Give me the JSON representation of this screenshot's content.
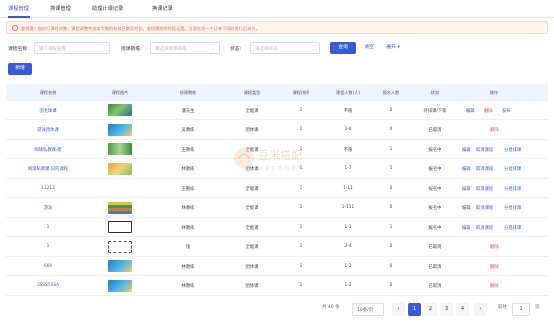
{
  "tabs": [
    {
      "label": "课程管理",
      "active": true
    },
    {
      "label": "排课管理",
      "active": false
    },
    {
      "label": "助理计课记录",
      "active": false
    },
    {
      "label": "换课记录",
      "active": false
    }
  ],
  "notice": "查找课：指执行课时调整，课程调整完成本学期的有效日期及时长。查找课程的时段设置。注意在同一个订单下同时进行后调价。",
  "filters": {
    "course_name_label": "课程名称:",
    "course_name_placeholder": "输入课程名称",
    "teacher_label": "授课教练:",
    "teacher_placeholder": "请选择授课教练",
    "status_label": "状态:",
    "status_placeholder": "请选择状态",
    "search_button": "查询",
    "reset_button": "清空",
    "expand_link": "展开"
  },
  "add_button": "新增",
  "columns": [
    "课程名称",
    "课程图片",
    "授课教练",
    "课程类型",
    "课程排序",
    "课程人数(人)",
    "报名人数",
    "状态",
    "操作"
  ],
  "rows": [
    {
      "name": "羽毛球课",
      "thumb": "thumb-court-green",
      "coach": "潘先生",
      "type": "全能课",
      "sort": "1",
      "capacity": "不限",
      "enrolled": "0",
      "status": "待排课/下架",
      "actions": [
        {
          "label": "编辑",
          "color": "blue"
        },
        {
          "label": "删除",
          "color": "red"
        },
        {
          "label": "发布",
          "color": "blue"
        }
      ]
    },
    {
      "name": "游泳团体课",
      "thumb": "thumb-pool-blue",
      "coach": "吴教练",
      "type": "团体课",
      "sort": "1",
      "capacity": "3-6",
      "enrolled": "0",
      "status": "已取消",
      "actions": [
        {
          "label": "删除",
          "color": "red"
        }
      ]
    },
    {
      "name": "网球私教课-新",
      "thumb": "thumb-tennis-green",
      "coach": "王教练",
      "type": "全能课",
      "sort": "1",
      "capacity": "不限",
      "enrolled": "1",
      "status": "报名中",
      "actions": [
        {
          "label": "编辑",
          "color": "blue"
        },
        {
          "label": "取消课程",
          "color": "blue"
        },
        {
          "label": "分批排课",
          "color": "blue"
        }
      ]
    },
    {
      "name": "网球私教课-旧的课程",
      "thumb": "thumb-kids-orange",
      "coach": "林教练",
      "type": "团体课",
      "sort": "1",
      "capacity": "1-7",
      "enrolled": "5",
      "status": "报名中",
      "actions": [
        {
          "label": "编辑",
          "color": "blue"
        },
        {
          "label": "取消课程",
          "color": "blue"
        },
        {
          "label": "分批排课",
          "color": "blue"
        }
      ]
    },
    {
      "name": "11212",
      "thumb": "",
      "coach": "王教练",
      "type": "全能课",
      "sort": "1",
      "capacity": "1-11",
      "enrolled": "0",
      "status": "报名中",
      "actions": [
        {
          "label": "编辑",
          "color": "blue"
        },
        {
          "label": "取消课程",
          "color": "blue"
        },
        {
          "label": "分批排课",
          "color": "blue"
        }
      ]
    },
    {
      "name": "游泳",
      "thumb": "thumb-stack-colorful",
      "coach": "林教练",
      "type": "全能课",
      "sort": "1",
      "capacity": "1-111",
      "enrolled": "0",
      "status": "报名中",
      "actions": [
        {
          "label": "编辑",
          "color": "blue"
        },
        {
          "label": "取消课程",
          "color": "blue"
        },
        {
          "label": "分批排课",
          "color": "blue"
        }
      ]
    },
    {
      "name": "1",
      "thumb": "thumb-logo-black",
      "coach": "林教练",
      "type": "全能课",
      "sort": "1",
      "capacity": "1-1",
      "enrolled": "1",
      "status": "报名中",
      "actions": [
        {
          "label": "编辑",
          "color": "blue"
        },
        {
          "label": "取消课程",
          "color": "blue"
        },
        {
          "label": "分批排课",
          "color": "blue"
        }
      ]
    },
    {
      "name": "1",
      "thumb": "thumb-text-black",
      "coach": "钱",
      "type": "全能课",
      "sort": "1",
      "capacity": "3-4",
      "enrolled": "0",
      "status": "已取消",
      "actions": [
        {
          "label": "删除",
          "color": "red"
        }
      ]
    },
    {
      "name": "666",
      "thumb": "thumb-pool-blue",
      "coach": "林教练",
      "type": "团体课",
      "sort": "1",
      "capacity": "1-2",
      "enrolled": "0",
      "status": "已取消",
      "actions": [
        {
          "label": "删除",
          "color": "red"
        }
      ]
    },
    {
      "name": "3SSS5SSA",
      "thumb": "thumb-pool-blue",
      "coach": "林教练",
      "type": "团体课",
      "sort": "1",
      "capacity": "1-2",
      "enrolled": "0",
      "status": "已取消",
      "actions": [
        {
          "label": "删除",
          "color": "red"
        }
      ]
    }
  ],
  "pagination": {
    "total": "共 40 条",
    "page_size": "10条/页",
    "pages": [
      "1",
      "2",
      "3",
      "4"
    ],
    "current": "1",
    "prev_icon": "chevron-left-icon",
    "next_icon": "chevron-right-icon",
    "goto_label": "前往",
    "goto_value": "1",
    "goto_unit": "页"
  },
  "watermark": {
    "title": "豆米搭配",
    "subtitle": "纵 享 生 态 科 技 乐"
  },
  "colors": {
    "primary": "#3a5bd6",
    "danger": "#e8463f",
    "notice": "#e8743f",
    "table_header": "#eef3fd"
  }
}
